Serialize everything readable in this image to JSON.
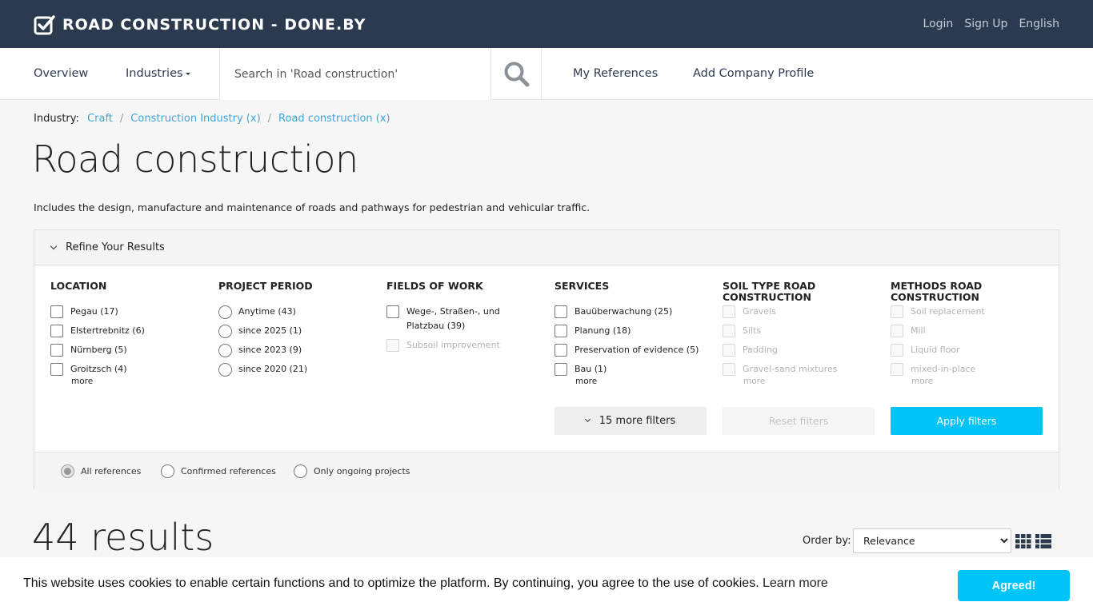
{
  "header": {
    "brand": "ROAD CONSTRUCTION - DONE.BY",
    "links": [
      "Login",
      "Sign Up",
      "English"
    ]
  },
  "nav": {
    "overview": "Overview",
    "industries": "Industries",
    "search_placeholder": "Search in 'Road construction'",
    "my_references": "My References",
    "add_company_profile": "Add Company Profile"
  },
  "breadcrumb": {
    "label": "Industry:",
    "items": [
      "Craft",
      "Construction Industry (x)",
      "Road construction (x)"
    ]
  },
  "page": {
    "title": "Road construction",
    "description": "Includes the design, manufacture and maintenance of roads and pathways for pedestrian and vehicular traffic."
  },
  "refine": {
    "toggle_label": "Refine Your Results",
    "columns": [
      {
        "heading": "LOCATION",
        "type": "checkbox",
        "options": [
          {
            "label": "Pegau (17)",
            "disabled": false
          },
          {
            "label": "Elstertrebnitz (6)",
            "disabled": false
          },
          {
            "label": "Nürnberg (5)",
            "disabled": false
          },
          {
            "label": "Groitzsch (4)",
            "disabled": false
          }
        ],
        "more": "more"
      },
      {
        "heading": "PROJECT PERIOD",
        "type": "radio",
        "options": [
          {
            "label": "Anytime (43)",
            "disabled": false
          },
          {
            "label": "since 2025 (1)",
            "disabled": false
          },
          {
            "label": "since 2023 (9)",
            "disabled": false
          },
          {
            "label": "since 2020 (21)",
            "disabled": false
          }
        ],
        "more": ""
      },
      {
        "heading": "FIELDS OF WORK",
        "type": "checkbox",
        "options": [
          {
            "label": "Wege-, Straßen-, und Platzbau (39)",
            "disabled": false
          },
          {
            "label": "Subsoil improvement",
            "disabled": true
          }
        ],
        "more": ""
      },
      {
        "heading": "SERVICES",
        "type": "checkbox",
        "options": [
          {
            "label": "Bauüberwachung (25)",
            "disabled": false
          },
          {
            "label": "Planung (18)",
            "disabled": false
          },
          {
            "label": "Preservation of evidence (5)",
            "disabled": false
          },
          {
            "label": "Bau (1)",
            "disabled": false
          }
        ],
        "more": "more"
      },
      {
        "heading": "SOIL TYPE ROAD CONSTRUCTION",
        "type": "checkbox",
        "options": [
          {
            "label": "Gravels",
            "disabled": true
          },
          {
            "label": "Silts",
            "disabled": true
          },
          {
            "label": "Padding",
            "disabled": true
          },
          {
            "label": "Gravel-sand mixtures",
            "disabled": true
          }
        ],
        "more": "more",
        "more_disabled": true
      },
      {
        "heading": "METHODS ROAD CONSTRUCTION",
        "type": "checkbox",
        "options": [
          {
            "label": "Soil replacement",
            "disabled": true
          },
          {
            "label": "Mill",
            "disabled": true
          },
          {
            "label": "Liquid floor",
            "disabled": true
          },
          {
            "label": "mixed-in-place",
            "disabled": true
          }
        ],
        "more": "more",
        "more_disabled": true
      }
    ],
    "more_filters": "15 more filters",
    "reset": "Reset filters",
    "apply": "Apply filters",
    "reference_filter": {
      "options": [
        "All references",
        "Confirmed references",
        "Only ongoing projects"
      ],
      "selected": "All references"
    }
  },
  "results": {
    "count_text": "44 results",
    "order_label": "Order by:",
    "order_options": [
      "Relevance"
    ],
    "order_selected": "Relevance"
  },
  "cookie": {
    "text": "This website uses cookies to enable certain functions and to optimize the platform. By continuing, you agree to the use of cookies.",
    "learn_more": "Learn more",
    "button": "Agreed!"
  },
  "colors": {
    "topbar": "#2c3a4f",
    "accent": "#00c4f6",
    "link": "#3ea6dc"
  }
}
